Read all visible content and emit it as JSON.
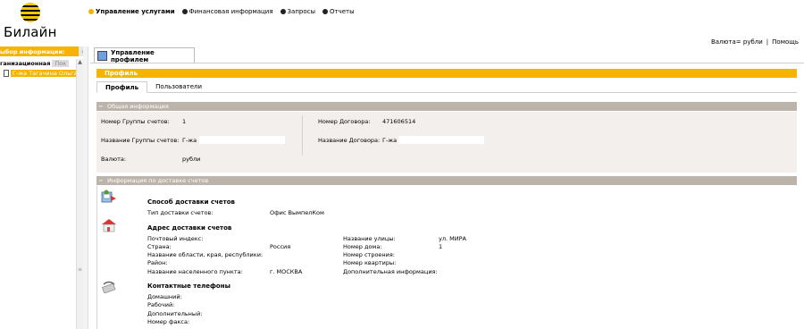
{
  "brand": {
    "logo_text": "Билайн",
    "accent_color": "#f5b400"
  },
  "topnav": {
    "items": [
      {
        "label": "Управление услугами",
        "active": true
      },
      {
        "label": "Финансовая информация",
        "active": false
      },
      {
        "label": "Запросы",
        "active": false
      },
      {
        "label": "Отчеты",
        "active": false
      }
    ]
  },
  "header_links": {
    "currency": "Валюта= рубли",
    "separator": "|",
    "help": "Помощь"
  },
  "left_panel": {
    "title": "ыбор информации:",
    "toggle_glyph": "‹",
    "row1_label": "ганизационная",
    "row1_hint": "Пок",
    "row2_label": "Г-жа Тагачина Ольга"
  },
  "main": {
    "tab_label": "Управление профилем",
    "section_bar": "Профиль",
    "subtabs": [
      {
        "label": "Профиль",
        "active": true
      },
      {
        "label": "Пользователи",
        "active": false
      }
    ]
  },
  "general_info": {
    "title": "Общая информация",
    "fields": {
      "group_number_label": "Номер Группы счетов:",
      "group_number_value": "1",
      "group_name_label": "Название Группы счетов:",
      "group_name_value": "Г-жа",
      "currency_label": "Валюта:",
      "currency_value": "рубли",
      "contract_number_label": "Номер Договора:",
      "contract_number_value": "471606514",
      "contract_name_label": "Название Договора:",
      "contract_name_value": "Г-жа"
    }
  },
  "delivery_info": {
    "title": "Информация по доставке счетов",
    "method": {
      "title": "Способ доставки счетов",
      "type_label": "Тип доставки счетов:",
      "type_value": "Офис ВымпелКом"
    },
    "address": {
      "title": "Адрес доставки счетов",
      "postal_label": "Почтовый индекс:",
      "country_label": "Страна:",
      "country_value": "Россия",
      "region_label": "Название области, края, республики:",
      "district_label": "Район:",
      "city_label": "Название населенного пункта:",
      "city_value": "г. МОСКВА",
      "street_label": "Название улицы:",
      "street_value": "ул. МИРА",
      "house_label": "Номер дома:",
      "house_value": "1",
      "building_label": "Номер строения:",
      "apartment_label": "Номер квартиры:",
      "extra_label": "Дополнительная информация:"
    },
    "phones": {
      "title": "Контактные телефоны",
      "home_label": "Домашний:",
      "work_label": "Рабочий:",
      "extra_label": "Дополнительный:",
      "fax_label": "Номер факса:"
    }
  }
}
